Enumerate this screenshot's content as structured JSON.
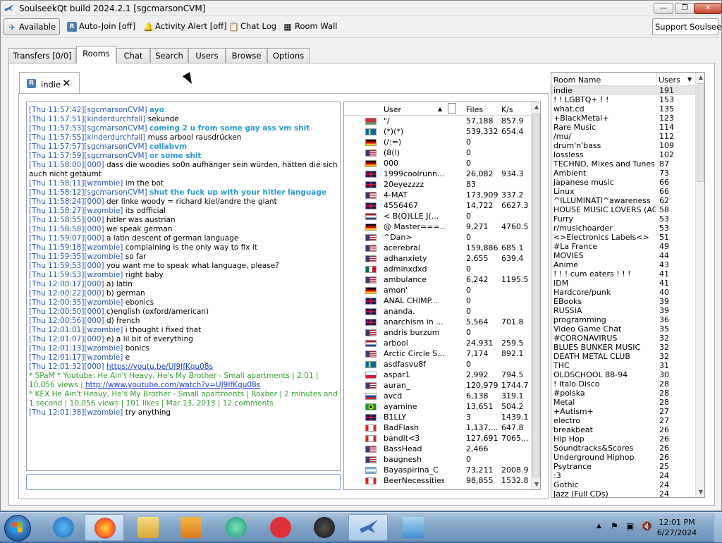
{
  "window": {
    "title": "SoulseekQt build 2024.2.1 [sgcmarsonCVM]",
    "min": "—",
    "max": "❐",
    "close": "✕"
  },
  "toolbar": {
    "available": "Available",
    "autojoin": "Auto-Join [off]",
    "activity": "Activity Alert [off]",
    "chatlog": "Chat Log",
    "roomwall": "Room Wall",
    "support": "Support Soulseek!"
  },
  "tabs": [
    "Transfers [0/0]",
    "Rooms",
    "Chat",
    "Search",
    "Users",
    "Browse",
    "Options"
  ],
  "room_tab": {
    "name": "indie",
    "close": "✕",
    "icon": "R"
  },
  "chat_lines": [
    {
      "ts": "[Thu 11:57:42]",
      "user": "[sgcmarsonCVM]",
      "text": "ayo",
      "me": true
    },
    {
      "ts": "[Thu 11:57:51]",
      "user": "[kinderdurchfall]",
      "text": "sekunde"
    },
    {
      "ts": "[Thu 11:57:53]",
      "user": "[sgcmarsonCVM]",
      "text": "coming 2 u from some gay ass vm shit",
      "me": true
    },
    {
      "ts": "[Thu 11:57:55]",
      "user": "[kinderdurchfall]",
      "text": "muss arbool rausdrücken"
    },
    {
      "ts": "[Thu 11:57:57]",
      "user": "[sgcmarsonCVM]",
      "text": "collabvm",
      "me": true
    },
    {
      "ts": "[Thu 11:57:59]",
      "user": "[sgcmarsonCVM]",
      "text": "or some shit",
      "me": true
    },
    {
      "ts": "[Thu 11:58:00]",
      "user": "[000]",
      "text": "dass die woodies so0n aufhänger sein würden, hätten die sich auch nicht getäumt"
    },
    {
      "ts": "[Thu 11:58:11]",
      "user": "[wzombie]",
      "text": "im the bot"
    },
    {
      "ts": "[Thu 11:58:12]",
      "user": "[sgcmarsonCVM]",
      "text": "shut the fuck up with your hitler language",
      "me": true
    },
    {
      "ts": "[Thu 11:58:24]",
      "user": "[000]",
      "text": "der linke woody = richard kiel/andre the giant"
    },
    {
      "ts": "[Thu 11:58:27]",
      "user": "[wzombie]",
      "text": "its odfficial"
    },
    {
      "ts": "[Thu 11:58:55]",
      "user": "[000]",
      "text": "hitler was austrian"
    },
    {
      "ts": "[Thu 11:58:58]",
      "user": "[000]",
      "text": "we speak german"
    },
    {
      "ts": "[Thu 11:59:07]",
      "user": "[000]",
      "text": "a latin descent of german language"
    },
    {
      "ts": "[Thu 11:59:18]",
      "user": "[wzombie]",
      "text": "complaining is the only way to fix it"
    },
    {
      "ts": "[Thu 11:59:35]",
      "user": "[wzombie]",
      "text": "so far"
    },
    {
      "ts": "[Thu 11:59:53]",
      "user": "[000]",
      "text": "you want me to speak what language, please?"
    },
    {
      "ts": "[Thu 11:59:53]",
      "user": "[wzombie]",
      "text": "right baby"
    },
    {
      "ts": "[Thu 12:00:17]",
      "user": "[000]",
      "text": "a) latin"
    },
    {
      "ts": "[Thu 12:00:22]",
      "user": "[000]",
      "text": "b) german"
    },
    {
      "ts": "[Thu 12:00:35]",
      "user": "[wzombie]",
      "text": "ebonics"
    },
    {
      "ts": "[Thu 12:00:50]",
      "user": "[000]",
      "text": "c)english (oxford/american)"
    },
    {
      "ts": "[Thu 12:00:56]",
      "user": "[000]",
      "text": "d) french"
    },
    {
      "ts": "[Thu 12:01:01]",
      "user": "[wzombie]",
      "text": "i thought i fixed that"
    },
    {
      "ts": "[Thu 12:01:07]",
      "user": "[000]",
      "text": "e) a lil bit of everything"
    },
    {
      "ts": "[Thu 12:01:13]",
      "user": "[wzombie]",
      "text": "bonics"
    },
    {
      "ts": "[Thu 12:01:17]",
      "user": "[wzombie]",
      "text": "e"
    },
    {
      "ts": "[Thu 12:01:32]",
      "user": "[000]",
      "text": "https://youtu.be/UJ9IfKqu08s",
      "link": true
    }
  ],
  "np_lines": [
    {
      "pre": "* SPaM * Youtube: He Ain't Heavy, He's My Brother - Small apartments | 2:01 | 10,056 views | ",
      "link": "http://www.youtube.com/watch?v=UJ9IfKqu08s"
    },
    {
      "pre": "* KEX He Ain't Heavy, He's My Brother - Small apartments | Roxber | 2 minutes and 1 second | 10,056 views | 101 likes | Mar 13, 2013 | 12 comments",
      "link": ""
    }
  ],
  "last_line": {
    "ts": "[Thu 12:01:38]",
    "user": "[wzombie]",
    "text": "try anything"
  },
  "user_headers": {
    "user": "User",
    "files": "Files",
    "speed": "K/s"
  },
  "users": [
    {
      "flag": "by",
      "name": "\"/",
      "files": "57,188",
      "speed": "857.9"
    },
    {
      "flag": "se",
      "name": "(*)(*)",
      "files": "539,332",
      "speed": "654.4"
    },
    {
      "flag": "de",
      "name": "(/:=)",
      "files": "0",
      "speed": ""
    },
    {
      "flag": "us",
      "name": "(8(l)",
      "files": "0",
      "speed": ""
    },
    {
      "flag": "de",
      "name": "000",
      "files": "0",
      "speed": ""
    },
    {
      "flag": "gb",
      "name": "1999coolrunn...",
      "files": "26,082",
      "speed": "934.3"
    },
    {
      "flag": "gb",
      "name": "20eyezzzz",
      "files": "83",
      "speed": ""
    },
    {
      "flag": "us",
      "name": "4-MAT",
      "files": "173,909",
      "speed": "337.2"
    },
    {
      "flag": "gb",
      "name": "4556467",
      "files": "14,722",
      "speed": "6627.3"
    },
    {
      "flag": "nl",
      "name": "< B(Q)LLE J(...",
      "files": "0",
      "speed": ""
    },
    {
      "flag": "de",
      "name": "@ Master===...",
      "files": "9,271",
      "speed": "4760.5"
    },
    {
      "flag": "us",
      "name": "^Dan>",
      "files": "0",
      "speed": ""
    },
    {
      "flag": "us",
      "name": "acerebral",
      "files": "159,886",
      "speed": "685.1"
    },
    {
      "flag": "us",
      "name": "adhanxiety",
      "files": "2,655",
      "speed": "639.4"
    },
    {
      "flag": "mx",
      "name": "adminxdxd",
      "files": "0",
      "speed": ""
    },
    {
      "flag": "us",
      "name": "ambulance",
      "files": "6,242",
      "speed": "1195.5"
    },
    {
      "flag": "de",
      "name": "amon'",
      "files": "0",
      "speed": ""
    },
    {
      "flag": "gb",
      "name": "ANAL CHIMP...",
      "files": "0",
      "speed": ""
    },
    {
      "flag": "gb",
      "name": "ananda.",
      "files": "0",
      "speed": ""
    },
    {
      "flag": "gb",
      "name": "anarchism in ...",
      "files": "5,564",
      "speed": "701.8"
    },
    {
      "flag": "us",
      "name": "andris burzum",
      "files": "0",
      "speed": ""
    },
    {
      "flag": "nl",
      "name": "arbool",
      "files": "24,931",
      "speed": "259.5"
    },
    {
      "flag": "us",
      "name": "Arctic Circle S...",
      "files": "7,174",
      "speed": "892.1"
    },
    {
      "flag": "se",
      "name": "asdfasvu8f",
      "files": "0",
      "speed": ""
    },
    {
      "flag": "pl",
      "name": "aspar1",
      "files": "2,992",
      "speed": "794.5"
    },
    {
      "flag": "us",
      "name": "auran_",
      "files": "120,979",
      "speed": "1744.7"
    },
    {
      "flag": "sk",
      "name": "avcd",
      "files": "6,138",
      "speed": "319.1"
    },
    {
      "flag": "br",
      "name": "ayamine",
      "files": "13,651",
      "speed": "504.2"
    },
    {
      "flag": "gb",
      "name": "B1LLY",
      "files": "3",
      "speed": "1439.1"
    },
    {
      "flag": "ca",
      "name": "BadFlash",
      "files": "1,137,...",
      "speed": "647.8"
    },
    {
      "flag": "ca",
      "name": "bandit<3",
      "files": "127,691",
      "speed": "7065...."
    },
    {
      "flag": "us",
      "name": "BassHead",
      "files": "2,466",
      "speed": ""
    },
    {
      "flag": "us",
      "name": "baugnesh",
      "files": "0",
      "speed": ""
    },
    {
      "flag": "ar",
      "name": "Bayaspirina_C",
      "files": "73,211",
      "speed": "2008.9"
    },
    {
      "flag": "ca",
      "name": "BeerNecessities",
      "files": "98,855",
      "speed": "1532.8"
    }
  ],
  "room_headers": {
    "name": "Room Name",
    "users": "Users"
  },
  "rooms": [
    {
      "name": "indie",
      "users": "191"
    },
    {
      "name": "! ! LGBTQ+ ! !",
      "users": "153"
    },
    {
      "name": "what.cd",
      "users": "135"
    },
    {
      "name": "+BlackMetal+",
      "users": "123"
    },
    {
      "name": "Rare Music",
      "users": "114"
    },
    {
      "name": "/mu/",
      "users": "112"
    },
    {
      "name": "drum'n'bass",
      "users": "109"
    },
    {
      "name": "lossless",
      "users": "102"
    },
    {
      "name": "TECHNO, Mixes and Tunes",
      "users": "87"
    },
    {
      "name": "Ambient",
      "users": "73"
    },
    {
      "name": "japanese music",
      "users": "66"
    },
    {
      "name": "Linux",
      "users": "66"
    },
    {
      "name": "^ILLUMINATI^awareness",
      "users": "62"
    },
    {
      "name": "HOUSE MUSIC LOVERS (AG)",
      "users": "58"
    },
    {
      "name": "Furry",
      "users": "53"
    },
    {
      "name": "r/musichoarder",
      "users": "53"
    },
    {
      "name": "<>Electronics Labels<>",
      "users": "51"
    },
    {
      "name": "#La France",
      "users": "49"
    },
    {
      "name": "MOVIES",
      "users": "44"
    },
    {
      "name": "Anime",
      "users": "43"
    },
    {
      "name": "! ! ! cum eaters ! ! !",
      "users": "41"
    },
    {
      "name": "IDM",
      "users": "41"
    },
    {
      "name": "Hardcore/punk",
      "users": "40"
    },
    {
      "name": "EBooks",
      "users": "39"
    },
    {
      "name": "RUSSIA",
      "users": "39"
    },
    {
      "name": "programming",
      "users": "36"
    },
    {
      "name": "Video Game Chat",
      "users": "35"
    },
    {
      "name": "#CORONAVIRUS",
      "users": "32"
    },
    {
      "name": "BLUES BUNKER MUSIC",
      "users": "32"
    },
    {
      "name": "DEATH METAL CLUB",
      "users": "32"
    },
    {
      "name": "THC",
      "users": "31"
    },
    {
      "name": "OLDSCHOOL 88-94",
      "users": "30"
    },
    {
      "name": "! Italo Disco",
      "users": "28"
    },
    {
      "name": "#polska",
      "users": "28"
    },
    {
      "name": "Metal",
      "users": "28"
    },
    {
      "name": "+Autism+",
      "users": "27"
    },
    {
      "name": "electro",
      "users": "27"
    },
    {
      "name": "breakbeat",
      "users": "26"
    },
    {
      "name": "Hip Hop",
      "users": "26"
    },
    {
      "name": "Soundtracks&Scores",
      "users": "26"
    },
    {
      "name": "Underground Hiphop",
      "users": "26"
    },
    {
      "name": "Psytrance",
      "users": "25"
    },
    {
      "name": ":3",
      "users": "24"
    },
    {
      "name": "Gothic",
      "users": "24"
    },
    {
      "name": "Jazz (Full CDs)",
      "users": "24"
    }
  ],
  "taskbar": {
    "time": "12:01 PM",
    "date": "6/27/2024",
    "apps": [
      "ie-icon",
      "firefox-icon",
      "explorer-icon",
      "media-player-icon",
      "chat-icon",
      "vivaldi-icon",
      "angry-bird-icon",
      "soulseek-icon",
      "picture-viewer-icon"
    ]
  },
  "colors": {
    "accent": "#2b9bd4",
    "timestamp": "#2a58b0",
    "nowplaying": "#36a036",
    "link": "#1b3fd4"
  }
}
